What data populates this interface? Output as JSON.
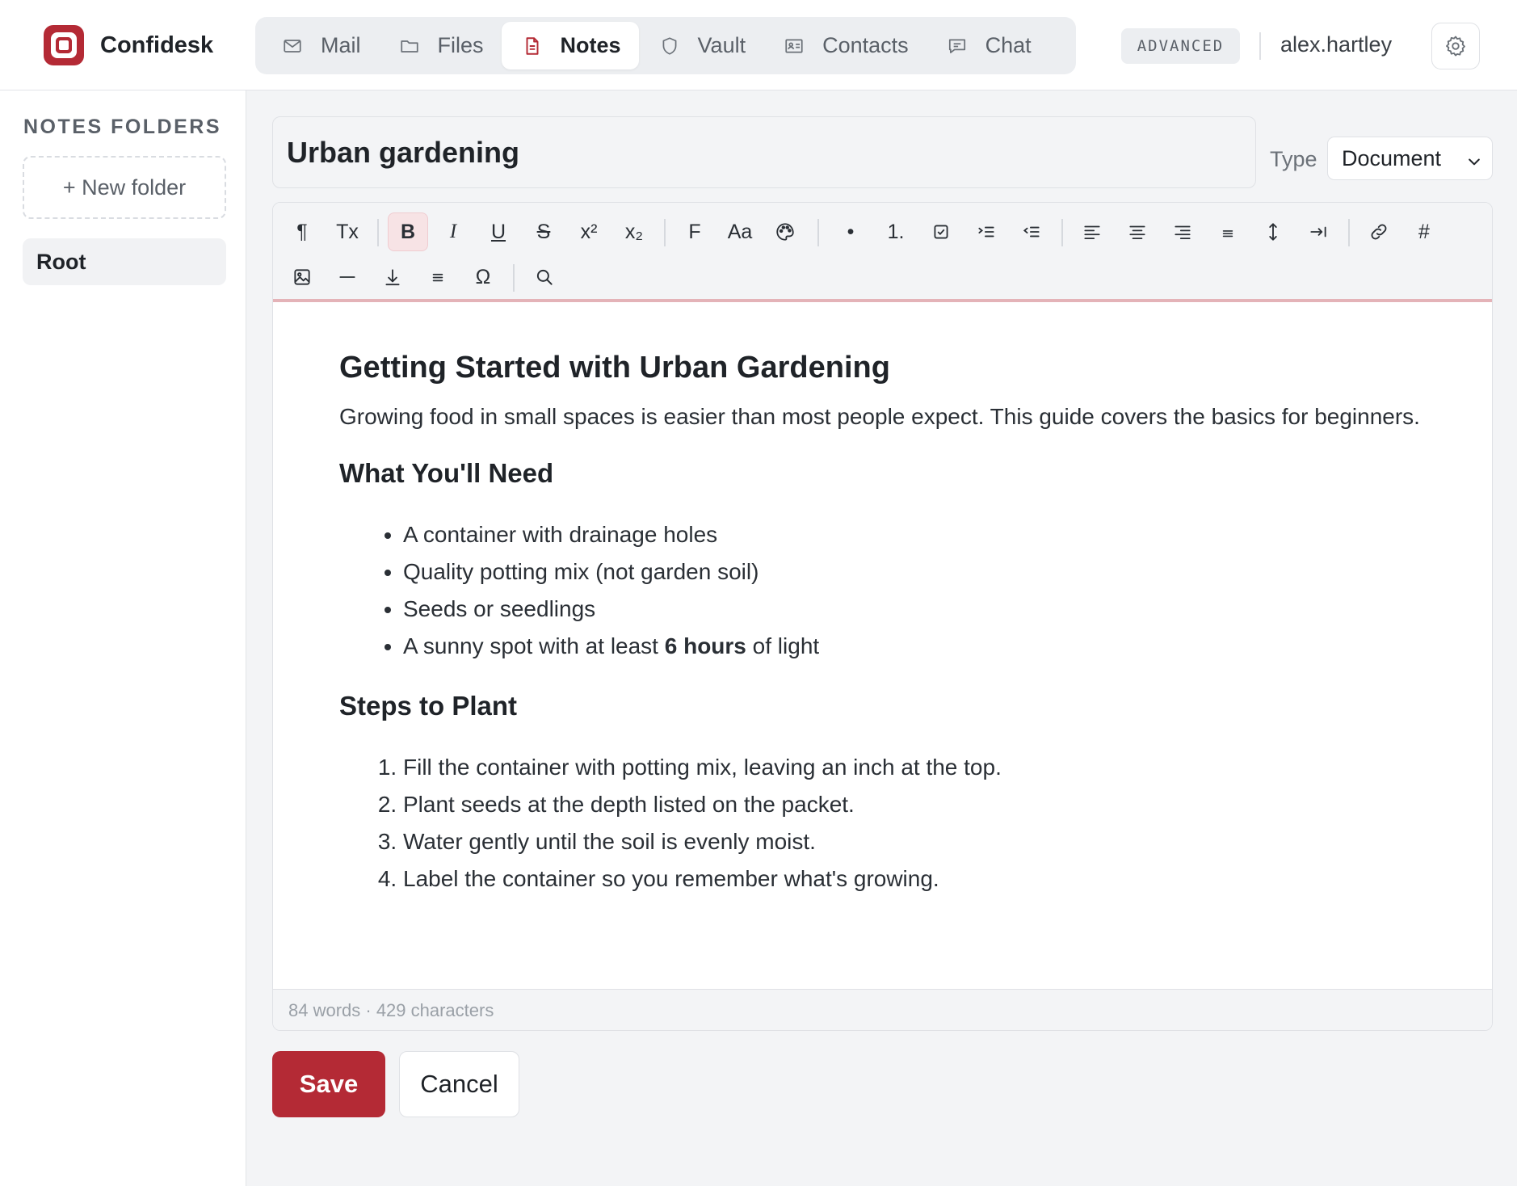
{
  "app": {
    "name": "Confidesk"
  },
  "nav": {
    "tabs": [
      {
        "label": "Mail",
        "icon": "mail-icon"
      },
      {
        "label": "Files",
        "icon": "folder-icon"
      },
      {
        "label": "Notes",
        "icon": "note-icon",
        "active": true
      },
      {
        "label": "Vault",
        "icon": "shield-icon"
      },
      {
        "label": "Contacts",
        "icon": "contact-card-icon"
      },
      {
        "label": "Chat",
        "icon": "chat-icon"
      }
    ]
  },
  "header": {
    "badge": "ADVANCED",
    "username": "alex.hartley",
    "settings_icon": "gear-icon"
  },
  "sidebar": {
    "title": "NOTES FOLDERS",
    "new_folder_label": "+ New folder",
    "folders": [
      "Root"
    ]
  },
  "note": {
    "title": "Urban gardening",
    "type_label": "Type",
    "type_value": "Document"
  },
  "toolbar": {
    "paragraph": "¶",
    "clear_format": "Tx",
    "bold": "B",
    "italic": "I",
    "underline": "U",
    "strike": "S",
    "superscript": "x²",
    "subscript": "x₂",
    "font": "F",
    "font_size": "Aa",
    "bullet": "•",
    "numbered": "1.",
    "hash": "#",
    "omega": "Ω",
    "active": "bold"
  },
  "document": {
    "heading": "Getting Started with Urban Gardening",
    "intro": "Growing food in small spaces is easier than most people expect. This guide covers the basics for beginners.",
    "needs_heading": "What You'll Need",
    "needs": [
      "A container with drainage holes",
      "Quality potting mix (not garden soil)",
      "Seeds or seedlings"
    ],
    "needs_last": {
      "before": "A sunny spot with at least ",
      "bold": "6 hours",
      "after": " of light"
    },
    "steps_heading": "Steps to Plant",
    "steps": [
      "Fill the container with potting mix, leaving an inch at the top.",
      "Plant seeds at the depth listed on the packet.",
      "Water gently until the soil is evenly moist.",
      "Label the container so you remember what's growing."
    ]
  },
  "status": {
    "counts": "84 words · 429 characters"
  },
  "actions": {
    "save": "Save",
    "cancel": "Cancel"
  },
  "colors": {
    "accent": "#b42a35",
    "accent_soft": "#f7e3e5"
  }
}
